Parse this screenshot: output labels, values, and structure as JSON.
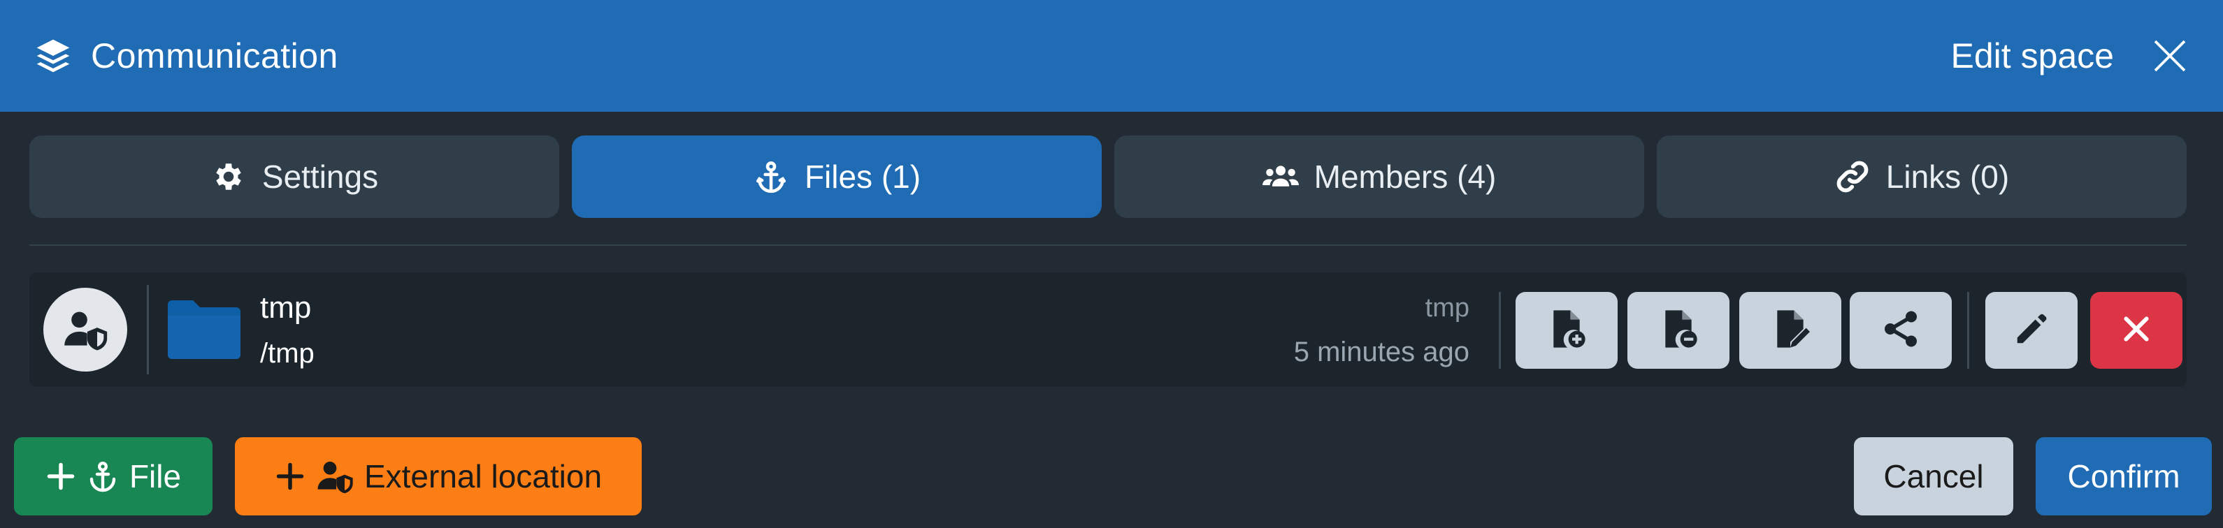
{
  "header": {
    "title": "Communication",
    "action_label": "Edit space"
  },
  "tabs": [
    {
      "label": "Settings",
      "icon": "gear-icon",
      "active": false
    },
    {
      "label": "Files (1)",
      "icon": "anchor-icon",
      "active": true
    },
    {
      "label": "Members (4)",
      "icon": "users-icon",
      "active": false
    },
    {
      "label": "Links (0)",
      "icon": "link-icon",
      "active": false
    }
  ],
  "file_row": {
    "name": "tmp",
    "path": "/tmp",
    "owner": "tmp",
    "modified": "5 minutes ago"
  },
  "footer": {
    "file_button": "File",
    "external_button": "External location",
    "cancel": "Cancel",
    "confirm": "Confirm"
  },
  "colors": {
    "primary": "#1f6bb4",
    "success": "#198754",
    "warning": "#fd7e14",
    "danger": "#dc3545",
    "background": "#222b33"
  }
}
